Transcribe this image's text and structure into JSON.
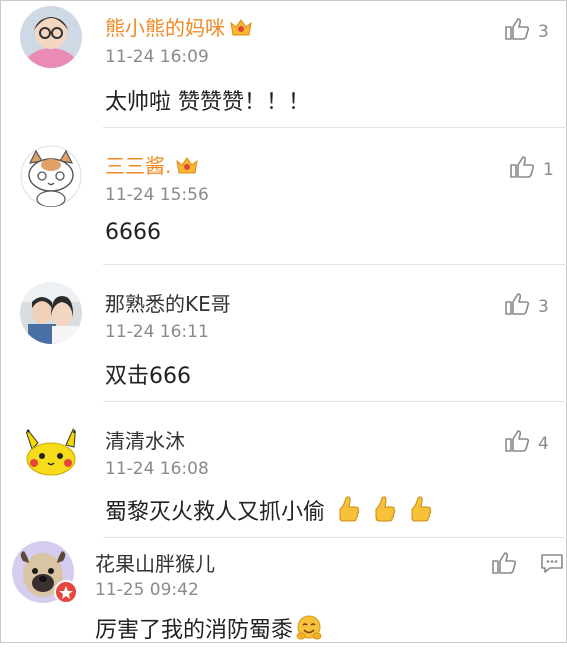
{
  "comments": [
    {
      "name": "熊小熊的妈咪",
      "time": "11-24 16:09",
      "text": "太帅啦 赞赞赞！！！",
      "likes": "3",
      "vip": true
    },
    {
      "name": "三三酱.",
      "time": "11-24 15:56",
      "text": "6666",
      "likes": "1",
      "vip": true
    },
    {
      "name": "那熟悉的KE哥",
      "time": "11-24 16:11",
      "text": "双击666",
      "likes": "3",
      "vip": false
    },
    {
      "name": "清清水沐",
      "time": "11-24 16:08",
      "text": "蜀黎灭火救人又抓小偷",
      "likes": "4",
      "vip": false,
      "emoji": "thumbs-up-emoji"
    },
    {
      "name": "花果山胖猴儿",
      "time": "11-25 09:42",
      "text": "厉害了我的消防蜀黍",
      "likes": "",
      "vip": false,
      "emoji": "hug-emoji"
    }
  ],
  "colors": {
    "vip_name": "#f08a24",
    "plain_name": "#333333",
    "meta": "#8a8a8a"
  }
}
